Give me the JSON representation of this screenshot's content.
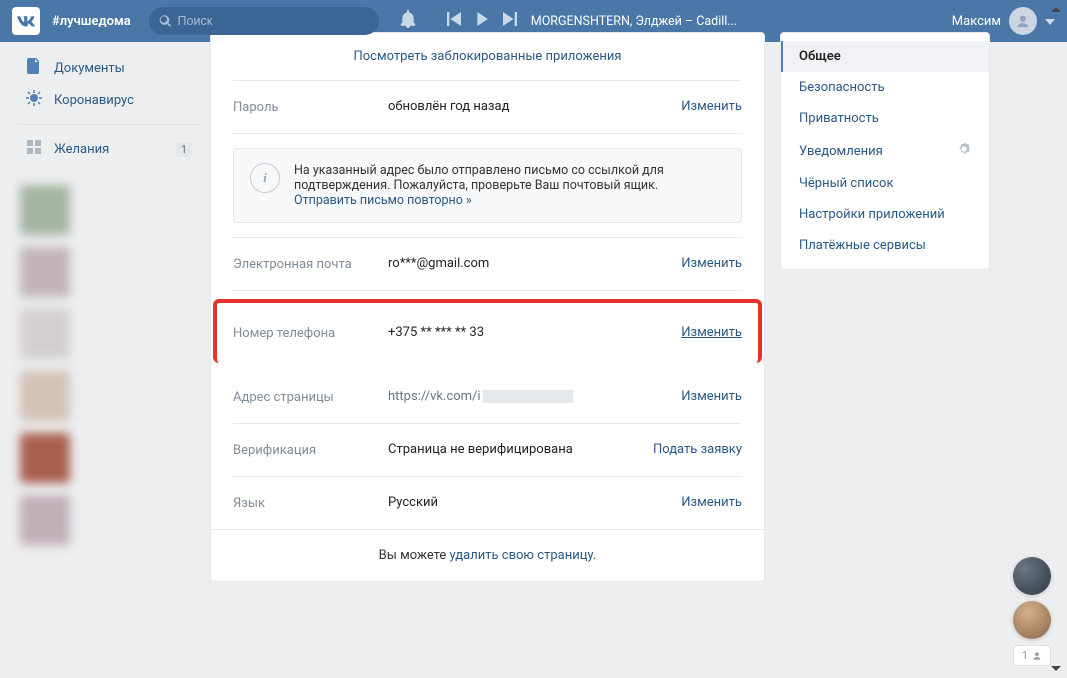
{
  "header": {
    "hashtag": "#лучшедома",
    "search_placeholder": "Поиск",
    "track": "MORGENSHTERN, Элджей – Cadill...",
    "username": "Максим"
  },
  "left_menu": {
    "documents": "Документы",
    "corona": "Коронавирус",
    "wishes": "Желания",
    "wishes_badge": "1"
  },
  "main": {
    "blocked_apps_link": "Посмотреть заблокированные приложения",
    "password": {
      "label": "Пароль",
      "value": "обновлён год назад",
      "action": "Изменить"
    },
    "info_text": "На указанный адрес было отправлено письмо со ссылкой для подтверждения. Пожалуйста, проверьте Ваш почтовый ящик.",
    "info_link": "Отправить письмо повторно »",
    "email": {
      "label": "Электронная почта",
      "value": "ro***@gmail.com",
      "action": "Изменить"
    },
    "phone": {
      "label": "Номер телефона",
      "value": "+375 ** *** ** 33",
      "action": "Изменить"
    },
    "address": {
      "label": "Адрес страницы",
      "url_prefix": "https://vk.com/i",
      "action": "Изменить"
    },
    "verification": {
      "label": "Верификация",
      "value": "Страница не верифицирована",
      "action": "Подать заявку"
    },
    "language": {
      "label": "Язык",
      "value": "Русский",
      "action": "Изменить"
    },
    "delete_prefix": "Вы можете ",
    "delete_link": "удалить свою страницу",
    "delete_suffix": "."
  },
  "settings_nav": {
    "general": "Общее",
    "security": "Безопасность",
    "privacy": "Приватность",
    "notifications": "Уведомления",
    "blacklist": "Чёрный список",
    "apps": "Настройки приложений",
    "payments": "Платёжные сервисы"
  },
  "float": {
    "count": "1"
  }
}
